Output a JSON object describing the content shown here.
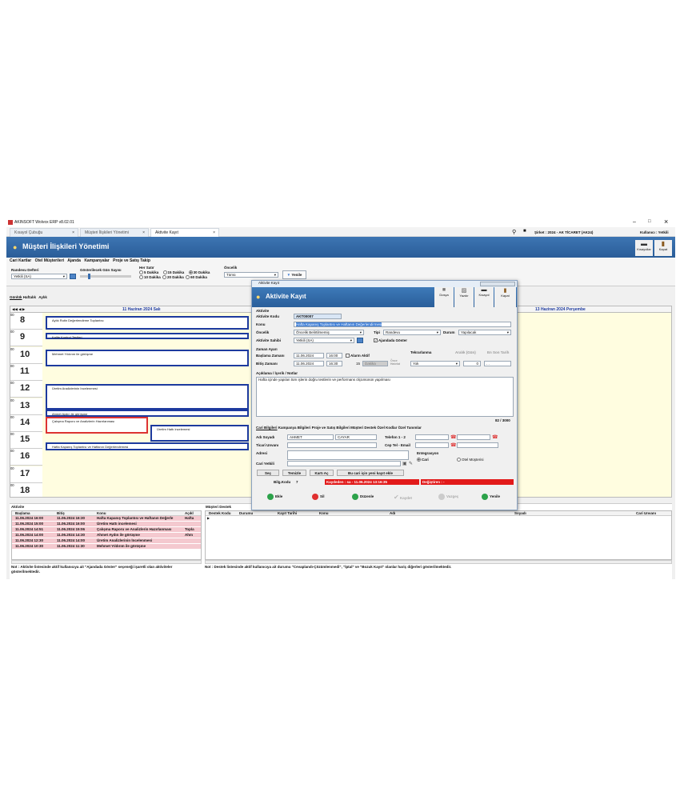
{
  "window": {
    "title": "AKINSOFT Wolvox ERP v8.02.01",
    "min": "–",
    "max": "□",
    "close": "×"
  },
  "browser_tabs": [
    {
      "label": "Kısayol Çubuğu",
      "close": "×"
    },
    {
      "label": "Müşteri İlişkileri Yönetimi",
      "close": "×"
    },
    {
      "label": "Aktivite Kayıt",
      "close": "×"
    }
  ],
  "status": {
    "company": "Şirket : 2024 - AK TİCARET (AK24)",
    "user": "Kullanıcı : Yetkili"
  },
  "header": {
    "title": "Müşteri İlişkileri Yönetimi",
    "tools": [
      {
        "label": "Kısayollar"
      },
      {
        "label": "Kapat"
      }
    ]
  },
  "menu": [
    "Cari Kartlar",
    "Otel Müşterileri",
    "Ajanda",
    "Kampanyalar",
    "Proje ve Satış Takip"
  ],
  "filters": {
    "randevu_label": "Randevu Defteri",
    "randevu_value": "Yetkili (SA)",
    "gun_label": "Gösterilecek Gün Sayısı",
    "satir_label": "Her Satır",
    "intervals": [
      "5 Dakika",
      "15 Dakika",
      "30 Dakika",
      "10 Dakika",
      "20 Dakika",
      "60 Dakika"
    ],
    "selected_interval": "30 Dakika",
    "oncelik_label": "Öncelik",
    "oncelik_value": "Tümü",
    "refresh": "Yenile"
  },
  "view_tabs": [
    "Günlük",
    "Haftalık",
    "Aylık"
  ],
  "calendar": {
    "day1": "11 Haziran 2024 Salı",
    "day3": "13 Haziran 2024 Perşembe",
    "hours": [
      "8",
      "9",
      "10",
      "11",
      "12",
      "13",
      "14",
      "15",
      "16",
      "17",
      "18"
    ],
    "minute": "00",
    "appointments": [
      "Aylık Rutin Değerlendirme Toplantısı",
      "Kalite Kontrol Testleri",
      "Mehmet Yıldırım ile görüşme",
      "Üretim Analizlerinin İncelenmesi",
      "Ahmet Aydın ile görüşme",
      "Çalışma Raporu ve Analizlerin Hazırlanması",
      "Üretim Hattı incelemesi",
      "Hafta Kapanış Toplantısı ve Haftanın Değerlendirmesi"
    ]
  },
  "activity_panel": {
    "title": "Aktivite",
    "columns": [
      "Başlama",
      "Bitiş",
      "Konu",
      "Açıkl"
    ],
    "rows": [
      [
        "11.06.2024 16:00",
        "11.06.2024 16:30",
        "Hafta Kapanış Toplantısı ve Haftanın Değerle",
        "Hafta"
      ],
      [
        "11.06.2024 15:00",
        "11.06.2024 16:00",
        "Üretim Hattı incelemesi",
        ""
      ],
      [
        "11.06.2024 14:51",
        "11.06.2024 15:06",
        "Çalışma Raporu ve Analizlerin Hazırlanması",
        "Topla"
      ],
      [
        "11.06.2024 14:00",
        "11.06.2024 14:30",
        "Ahmet Aydın ile görüşme",
        "Ahm"
      ],
      [
        "11.06.2024 12:30",
        "11.06.2024 14:00",
        "Üretim Analizlerinin İncelenmesi",
        ""
      ],
      [
        "11.06.2024 10:30",
        "11.06.2024 11:30",
        "Mehmet Yıldırım ile görüşme",
        ""
      ]
    ],
    "note": "Not : Aktivite listesinde aktif kullanıcıya ait \"Ajandada Göster\" seçeneği işaretli olan aktiviteler gösterilmektedir."
  },
  "support_panel": {
    "title": "Müşteri Destek",
    "columns": [
      "Destek Kodu",
      "Durumu",
      "Kayıt Tarihi",
      "Konu",
      "Adı",
      "Soyadı",
      "Cari Unvanı"
    ],
    "note": "Not : Destek listesinde aktif kullanıcıya ait durumu \"Cevaplandı-Çözümlenmedi\", \"İptal\" ve \"Bozuk Kayıt\" olanlar hariç diğerleri gösterilmektedir."
  },
  "dialog": {
    "window_title": "Aktivite Kayıt",
    "title": "Aktivite Kayıt",
    "tools": [
      "Dosya",
      "Yazdır",
      "Kısayol",
      "Kapat"
    ],
    "section": "Aktivite",
    "kod_label": "Aktivite Kodu",
    "kod": "AKT00007",
    "konu_label": "Konu",
    "konu": "Hafta Kapanış Toplantısı ve Haftanın Değerlendirmesi",
    "oncelik_label": "Öncelik",
    "oncelik": "Öncelik Belirtilmemiş",
    "tipi_label": "Tipi",
    "tipi": "Randevu",
    "durum_label": "Durum",
    "durum": "Yapılacak",
    "sahibi_label": "Aktivite Sahibi",
    "sahibi": "Yetkili (SA)",
    "ajanda_label": "Ajandada Göster",
    "zaman_label": "Zaman Ayarı",
    "bas_label": "Başlama Zamanı",
    "bas_tarih": "11.06.2024",
    "bas_saat": "16:00",
    "alarm_label": "Alarm Aktif",
    "bit_label": "Bitiş Zamanı",
    "bit_tarih": "11.06.2024",
    "bit_saat": "16:30",
    "alarm_value": "15",
    "alarm_unit": "Dakika",
    "alarm_once": "Önce Hatırlat",
    "tekrar_label": "Tekrarlanma",
    "tekrar": "Yok",
    "aralik_label": "Aralık (Gün)",
    "aralik": "0",
    "enson_label": "En Son Tarih",
    "enson": ". .",
    "aciklama_label": "Açıklama / İçerik / Notlar",
    "aciklama": "Hafta içinde yapılan tüm işlerin doğru testlerin ve performans ölçümünün yapılması",
    "counter": "82 / 3000",
    "subtabs": [
      "Cari Bilgileri",
      "Kampanya Bilgileri",
      "Proje ve Satış Bilgileri",
      "Müşteri Destek",
      "Özel Kodlar",
      "Özel Tanımlar"
    ],
    "adi_label": "Adı Soyadı",
    "adi": "AHMET",
    "soyadi": "CAYAR",
    "tel_label": "Telefon 1 - 2",
    "unvan_label": "Ticari Unvanı",
    "cep_label": "Cep Tel - Email",
    "adres_label": "Adresi",
    "cariyetkili_label": "Cari Yetkili",
    "entegrasyon_label": "Entegrasyon",
    "cari_opt": "Cari",
    "otel_opt": "Otel Müşterisi",
    "sec": "Seç",
    "temizle": "Temizle",
    "kartac": "Kartı Aç",
    "yenikayit": "Bu cari için yeni kayıt ekle",
    "bilgi_kodu": "Bilg.Kodu",
    "bilgi_val": "7",
    "kaydeden": "Kaydeden : sa - 11.06.2024 13:16:35",
    "degistiren": "Değiştiren : -",
    "buttons": [
      "Ekle",
      "Sil",
      "Düzenle",
      "Kaydet",
      "Vazgeç",
      "Yenile"
    ]
  }
}
